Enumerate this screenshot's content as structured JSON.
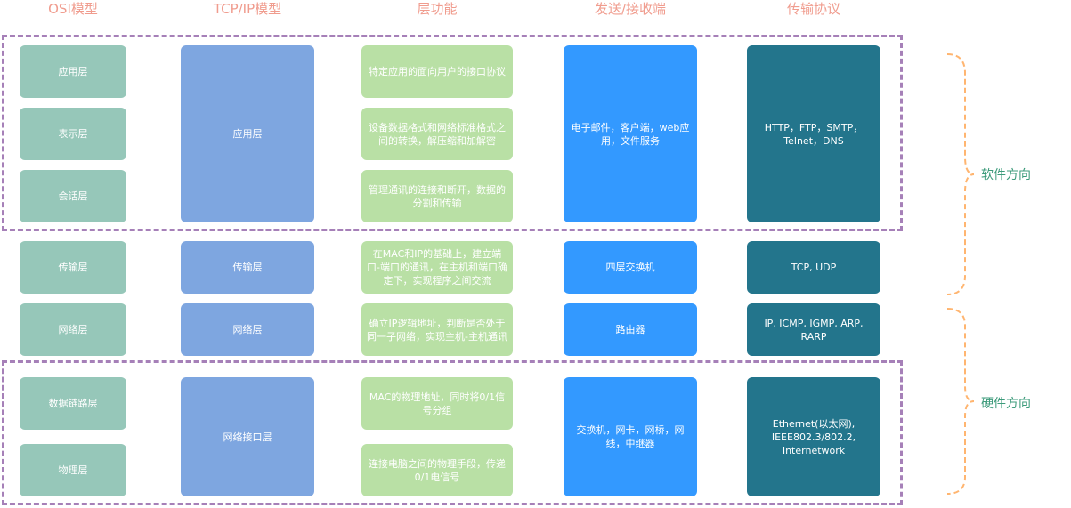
{
  "headers": {
    "osi": "OSI模型",
    "tcpip": "TCP/IP模型",
    "function": "层功能",
    "device": "发送/接收端",
    "protocol": "传输协议"
  },
  "osi_layers": [
    "应用层",
    "表示层",
    "会话层",
    "传输层",
    "网络层",
    "数据链路层",
    "物理层"
  ],
  "tcpip_layers": [
    "应用层",
    "传输层",
    "网络层",
    "网络接口层"
  ],
  "functions": [
    "特定应用的面向用户的接口协议",
    "设备数据格式和网络标准格式之间的转换，解压缩和加解密",
    "管理通讯的连接和断开，数据的分割和传输",
    "在MAC和IP的基础上，建立端口-端口的通讯，在主机和端口确定下，实现程序之间交流",
    "确立IP逻辑地址，判断是否处于同一子网络，实现主机-主机通讯",
    "MAC的物理地址，同时将0/1信号分组",
    "连接电脑之间的物理手段，传递0/1电信号"
  ],
  "devices": [
    "电子邮件，客户端，web应用，文件服务",
    "四层交换机",
    "路由器",
    "交换机，网卡，网桥，网线，中继器"
  ],
  "protocols": [
    "HTTP，FTP，SMTP，Telnet，DNS",
    "TCP, UDP",
    "IP, ICMP, IGMP, ARP, RARP",
    "Ethernet(以太网), IEEE802.3/802.2, Internetwork"
  ],
  "side_labels": {
    "software": "软件方向",
    "hardware": "硬件方向"
  },
  "colors": {
    "osi": "#96c7b9",
    "tcpip": "#7ea6e0",
    "function": "#b9e0a5",
    "device": "#3399ff",
    "protocol": "#23758c",
    "dashed_border": "#a680b8",
    "brace": "#ffb570",
    "header_text": "#f09c8e",
    "side_text": "#3d9b7b"
  }
}
